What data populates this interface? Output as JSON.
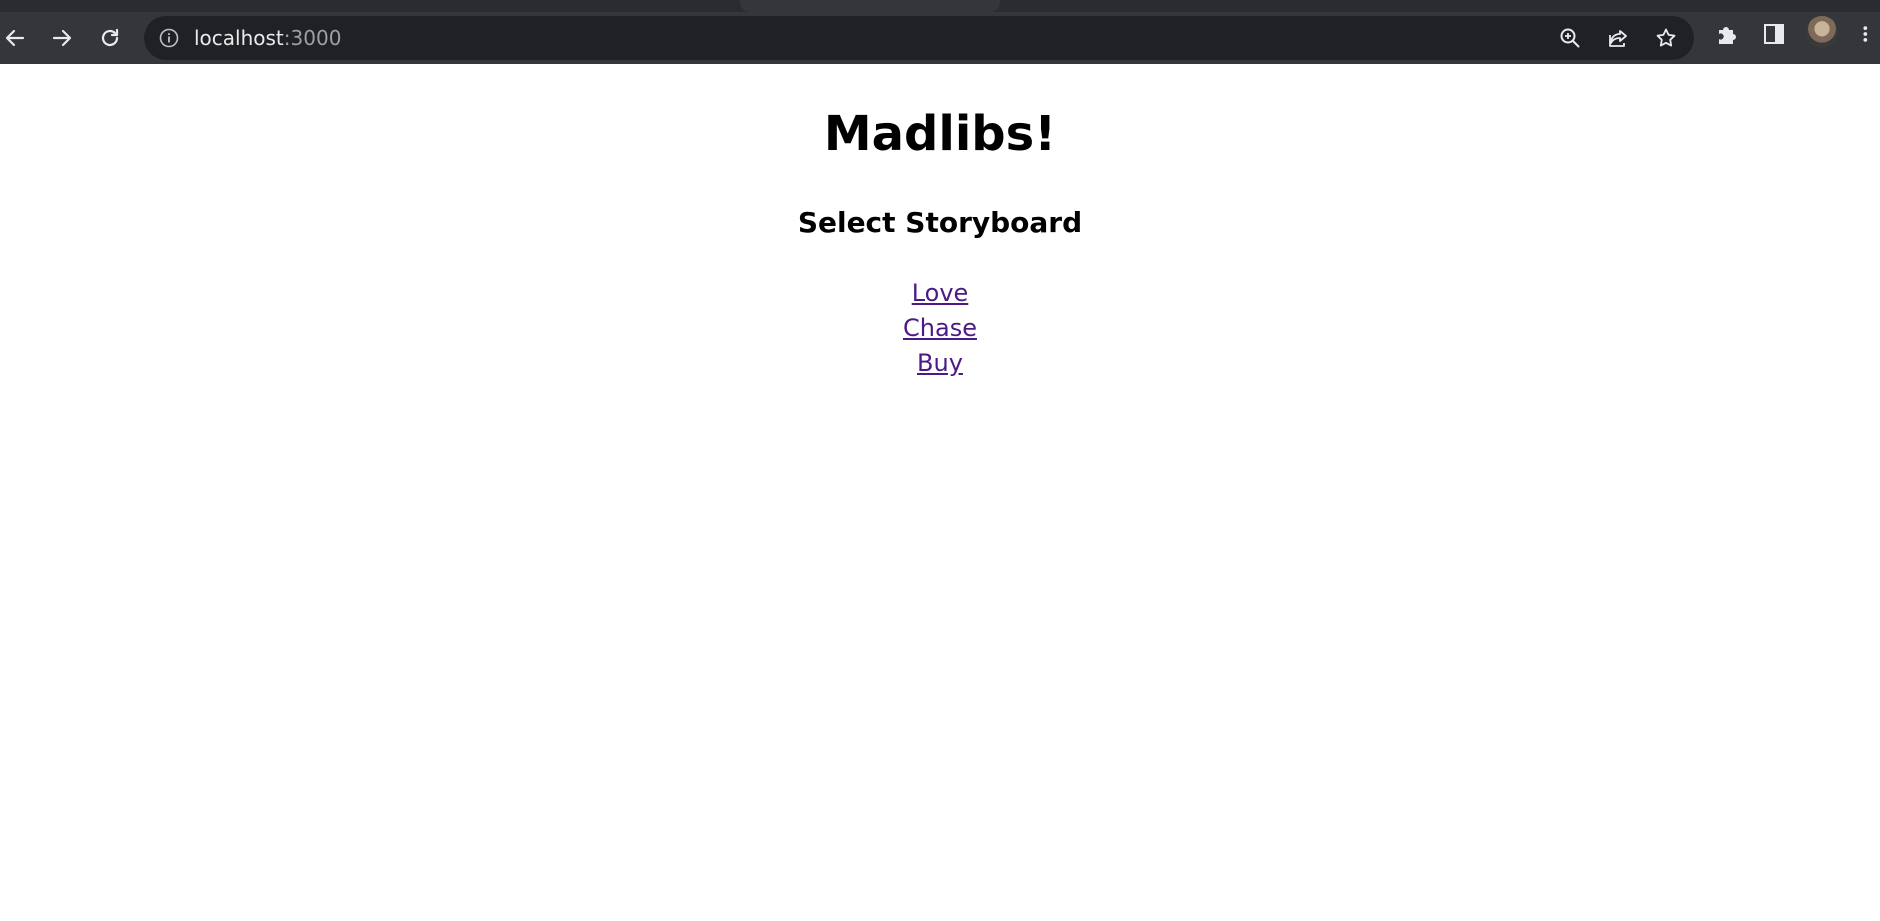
{
  "browser": {
    "url_host": "localhost",
    "url_port": ":3000",
    "icons": {
      "back": "back-arrow-icon",
      "forward": "forward-arrow-icon",
      "reload": "reload-icon",
      "site_info": "info-icon",
      "zoom": "zoom-icon",
      "share": "share-icon",
      "bookmark": "star-icon",
      "extensions": "puzzle-icon",
      "side_panel": "side-panel-icon",
      "menu": "kebab-menu-icon"
    },
    "colors": {
      "toolbar": "#35363a",
      "omnibox": "#202124"
    }
  },
  "page": {
    "title": "Madlibs!",
    "subtitle": "Select Storyboard",
    "storyboards": [
      "Love",
      "Chase",
      "Buy"
    ],
    "link_color": "#4b1a86"
  }
}
